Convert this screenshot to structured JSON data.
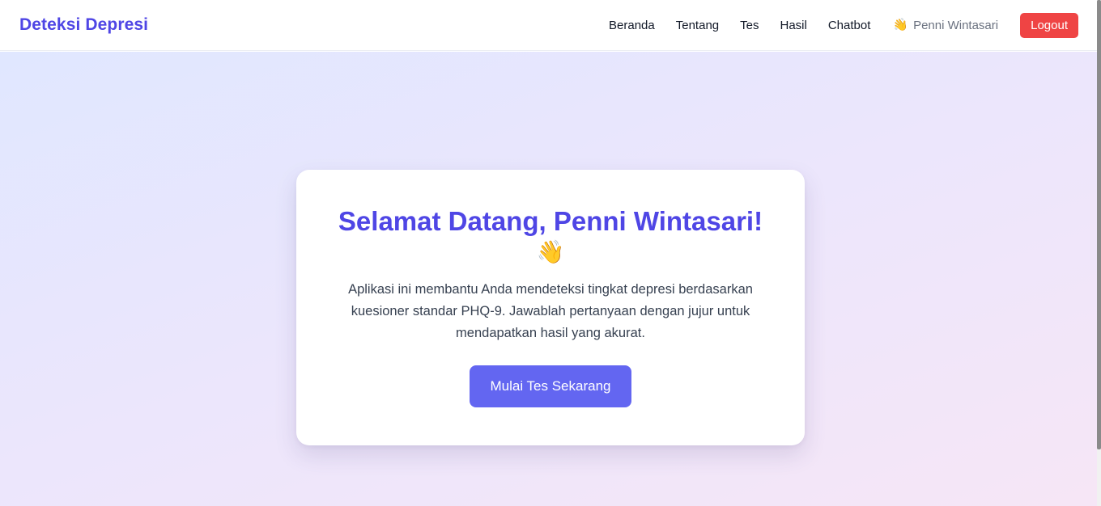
{
  "navbar": {
    "brand": "Deteksi Depresi",
    "links": [
      "Beranda",
      "Tentang",
      "Tes",
      "Hasil",
      "Chatbot"
    ],
    "user_emoji": "👋",
    "user_name": "Penni Wintasari",
    "logout_label": "Logout"
  },
  "hero": {
    "title": "Selamat Datang, Penni Wintasari!",
    "title_emoji": "👋",
    "description": "Aplikasi ini membantu Anda mendeteksi tingkat depresi berdasarkan kuesioner standar PHQ-9. Jawablah pertanyaan dengan jujur untuk mendapatkan hasil yang akurat.",
    "cta_label": "Mulai Tes Sekarang"
  },
  "colors": {
    "brand": "#4f46e5",
    "cta": "#6366f1",
    "logout": "#ef4444"
  }
}
